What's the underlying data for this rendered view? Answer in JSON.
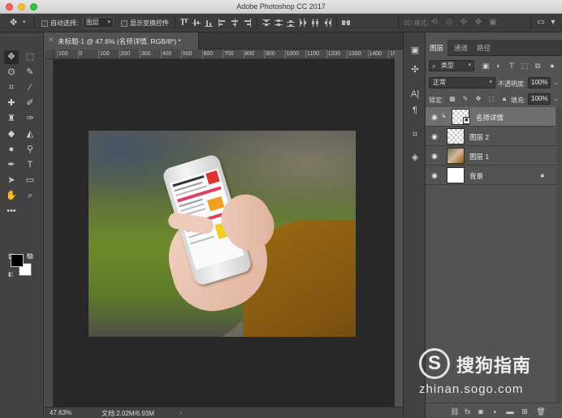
{
  "window": {
    "title": "Adobe Photoshop CC 2017"
  },
  "options_bar": {
    "auto_select_label": "自动选择:",
    "auto_select_value": "图层",
    "show_transform_label": "显示变换控件",
    "mode_3d_label": "3D 模式:"
  },
  "document": {
    "tab_title": "未标题-1 @ 47.6% (名师详情, RGB/8*) *",
    "ruler_labels": [
      "100",
      "0",
      "100",
      "200",
      "300",
      "400",
      "500",
      "600",
      "700",
      "800",
      "900",
      "1000",
      "1100",
      "1200",
      "1300",
      "1400",
      "1500"
    ]
  },
  "status_bar": {
    "zoom": "47.63%",
    "doc_info": "文档:2.02M/6.93M"
  },
  "layers_panel": {
    "tabs": [
      "图层",
      "通道",
      "路径"
    ],
    "filter_kind": "类型",
    "blend_mode": "正常",
    "opacity_label": "不透明度:",
    "opacity_value": "100%",
    "lock_label": "锁定:",
    "fill_label": "填充:",
    "fill_value": "100%",
    "layers": [
      {
        "name": "名师详情",
        "selected": true,
        "clipped": true,
        "smart_object": true
      },
      {
        "name": "图层 2",
        "selected": false
      },
      {
        "name": "图层 1",
        "selected": false
      },
      {
        "name": "背景",
        "selected": false,
        "locked": true
      }
    ]
  },
  "watermark": {
    "brand_cn": "搜狗指南",
    "url": "zhinan.sogo.com"
  },
  "colors": {
    "foreground": "#000000",
    "background": "#ffffff",
    "panel_bg": "#535353",
    "toolbar_bg": "#424242"
  }
}
